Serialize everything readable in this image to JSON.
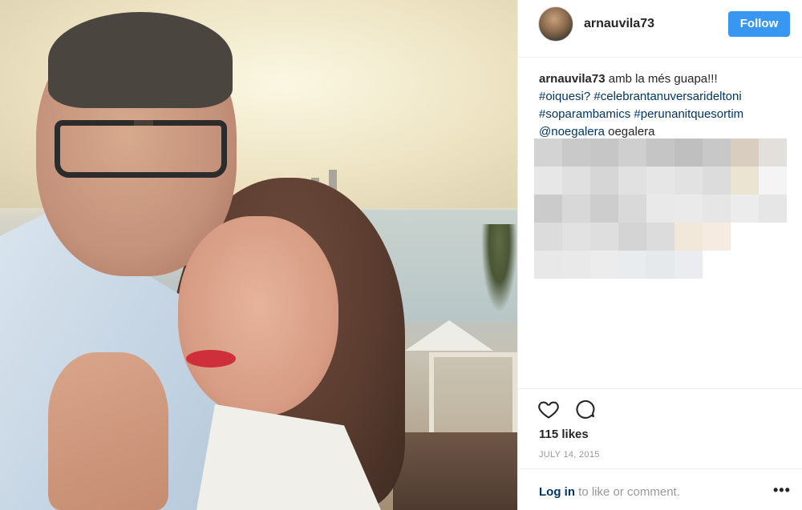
{
  "post": {
    "photo_label": "",
    "username": "arnauvila73",
    "follow_label": "Follow",
    "caption": {
      "username": "arnauvila73",
      "text": "amb la més guapa!!!",
      "hashtags": [
        "#oiquesi?",
        "#celebrantanuversarideltoni",
        "#soparambamics",
        "#perunanitquesortim"
      ],
      "mention": "@noegalera",
      "after_mention": "oegalera"
    },
    "likes": "115 likes",
    "date": "JULY 14, 2015",
    "login_link": "Log in",
    "login_text": "to like or comment.",
    "more_label": "•••"
  },
  "icons": {
    "like": "heart-icon",
    "comment": "comment-icon",
    "more": "more-options-icon"
  },
  "colors": {
    "follow_button": "#3897f0",
    "link": "#003569",
    "muted": "#999999"
  },
  "blur_pixels": [
    [
      "#d3d3d3",
      "#c9c9c9",
      "#c6c6c6",
      "#cfcfcf",
      "#c5c5c5",
      "#bfbfbf",
      "#c8c8c8",
      "#d8cdbf",
      "#e3e0dc"
    ],
    [
      "#e7e7e7",
      "#e0e0e0",
      "#d6d6d6",
      "#e1e1e1",
      "#e6e6e6",
      "#e2e2e2",
      "#dcdcdc",
      "#ece4d3",
      "#f4f4f4"
    ],
    [
      "#cbcbcb",
      "#d8d8d8",
      "#cdcdcd",
      "#d9d9d9",
      "#e9e9e9",
      "#eaeaea",
      "#e6e6e6",
      "#ececec",
      "#e6e6e6"
    ],
    [
      "#dcdcdc",
      "#e2e2e2",
      "#dedede",
      "#d4d4d4",
      "#dcdcdc",
      "#f1e8da",
      "#f5ebe0",
      "#ffffff",
      "#ffffff"
    ],
    [
      "#e8e8e8",
      "#e9e9e9",
      "#ececec",
      "#e9ecef",
      "#e6e9ec",
      "#eaecf0",
      "#ffffff",
      "#ffffff",
      "#ffffff"
    ]
  ]
}
